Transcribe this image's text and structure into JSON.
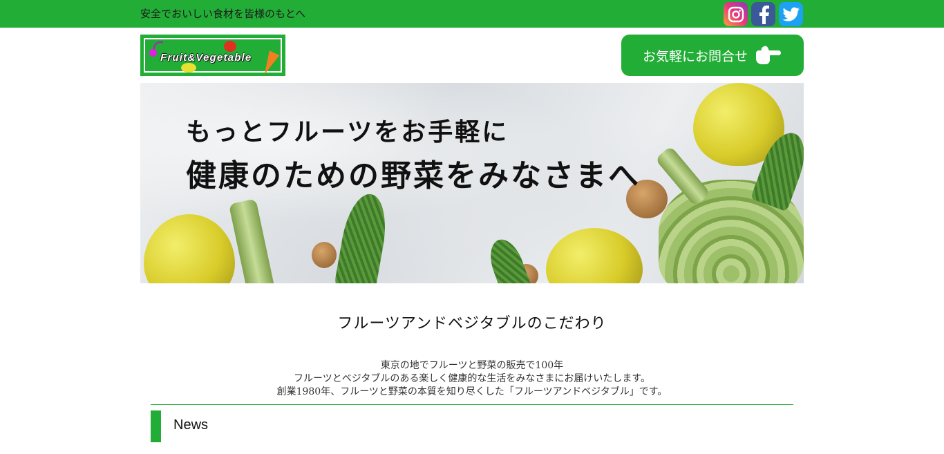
{
  "header": {
    "tagline": "安全でおいしい食材を皆様のもとへ",
    "social": [
      {
        "name": "instagram-icon",
        "glyph": "◎"
      },
      {
        "name": "facebook-icon",
        "glyph": "f"
      },
      {
        "name": "twitter-icon",
        "glyph": "🐦"
      }
    ],
    "logo_text": "Fruit&Vegetable",
    "contact_label": "お気軽にお問合せ",
    "accent_color": "#22ad37"
  },
  "hero": {
    "line1": "もっとフルーツをお手軽に",
    "line2": "健康のための野菜をみなさまへ"
  },
  "concept": {
    "title": "フルーツアンドベジタブルのこだわり",
    "lines": [
      "東京の地でフルーツと野菜の販売で100年",
      "フルーツとベジタブルのある楽しく健康的な生活をみなさまにお届けいたします。",
      "創業1980年、フルーツと野菜の本質を知り尽くした「フルーツアンドベジタブル」です。"
    ]
  },
  "news": {
    "title": "News"
  }
}
